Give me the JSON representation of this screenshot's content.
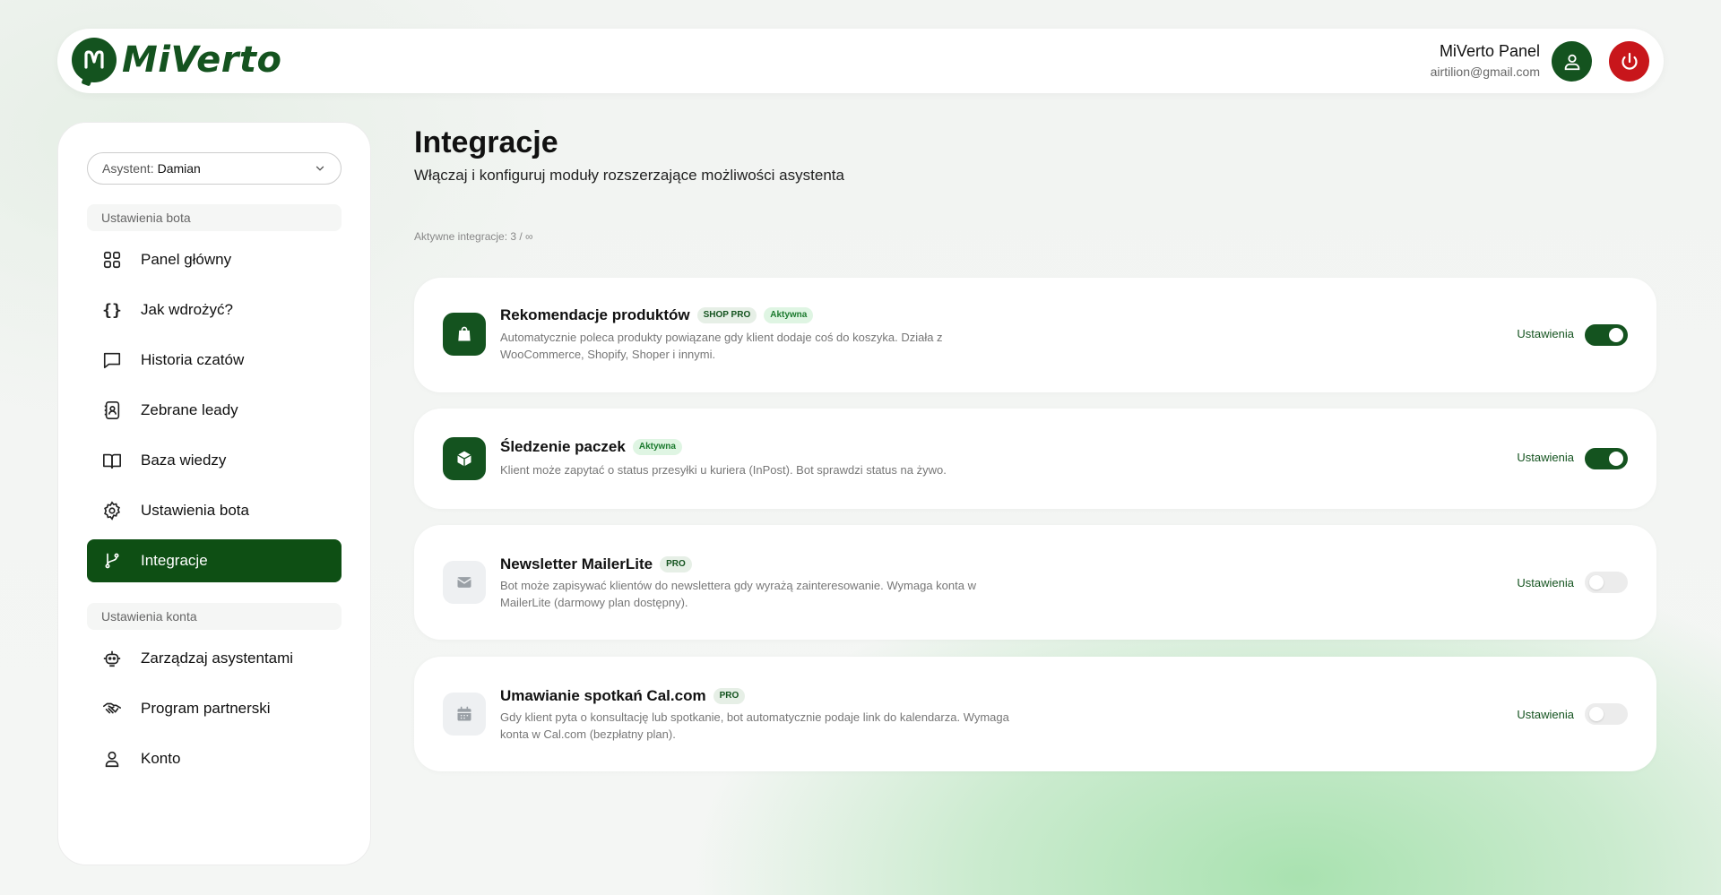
{
  "header": {
    "logo_text": "MiVerto",
    "user_name": "MiVerto Panel",
    "user_email": "airtilion@gmail.com"
  },
  "sidebar": {
    "assistant_label": "Asystent:",
    "assistant_value": "Damian",
    "section_bot": "Ustawienia bota",
    "section_account": "Ustawienia konta",
    "items": [
      {
        "label": "Panel główny",
        "icon": "grid-icon"
      },
      {
        "label": "Jak wdrożyć?",
        "icon": "braces-icon"
      },
      {
        "label": "Historia czatów",
        "icon": "chat-icon"
      },
      {
        "label": "Zebrane leady",
        "icon": "contact-book-icon"
      },
      {
        "label": "Baza wiedzy",
        "icon": "book-icon"
      },
      {
        "label": "Ustawienia bota",
        "icon": "gear-icon"
      },
      {
        "label": "Integracje",
        "icon": "git-branch-icon",
        "active": true
      },
      {
        "label": "Zarządzaj asystentami",
        "icon": "robot-icon"
      },
      {
        "label": "Program partnerski",
        "icon": "handshake-icon"
      },
      {
        "label": "Konto",
        "icon": "user-icon"
      }
    ]
  },
  "main": {
    "title": "Integracje",
    "subtitle": "Włączaj i konfiguruj moduły rozszerzające możliwości asystenta",
    "active_count": "Aktywne integracje: 3 / ∞",
    "settings_label": "Ustawienia",
    "integrations": [
      {
        "title": "Rekomendacje produktów",
        "badges": [
          "SHOP PRO",
          "Aktywna"
        ],
        "desc": "Automatycznie poleca produkty powiązane gdy klient dodaje coś do koszyka. Działa z WooCommerce, Shopify, Shoper i innymi.",
        "enabled": true,
        "icon": "shopping-bag-icon"
      },
      {
        "title": "Śledzenie paczek",
        "badges": [
          "Aktywna"
        ],
        "desc": "Klient może zapytać o status przesyłki u kuriera (InPost). Bot sprawdzi status na żywo.",
        "enabled": true,
        "icon": "package-icon"
      },
      {
        "title": "Newsletter MailerLite",
        "badges": [
          "PRO"
        ],
        "desc": "Bot może zapisywać klientów do newslettera gdy wyrażą zainteresowanie. Wymaga konta w MailerLite (darmowy plan dostępny).",
        "enabled": false,
        "icon": "envelope-icon"
      },
      {
        "title": "Umawianie spotkań Cal.com",
        "badges": [
          "PRO"
        ],
        "desc": "Gdy klient pyta o konsultację lub spotkanie, bot automatycznie podaje link do kalendarza. Wymaga konta w Cal.com (bezpłatny plan).",
        "enabled": false,
        "icon": "calendar-icon"
      }
    ]
  },
  "colors": {
    "brand": "#14531f",
    "danger": "#c8161b"
  }
}
